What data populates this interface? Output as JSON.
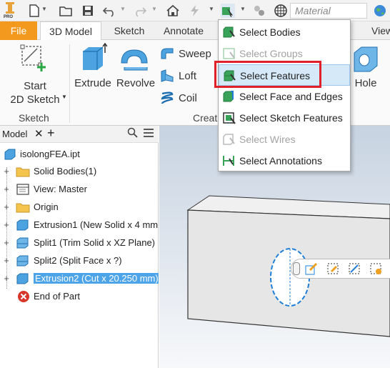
{
  "toolbar": {
    "material_placeholder": "Material",
    "icons": [
      "app-logo-icon",
      "new-file-icon",
      "open-icon",
      "save-icon",
      "undo-icon",
      "redo-icon",
      "home-icon",
      "update-icon",
      "select-filter-icon",
      "appearance-icon",
      "material-ball-icon",
      "globe-icon"
    ],
    "app_logo_text": "PRO"
  },
  "tabs": {
    "file": "File",
    "model": "3D Model",
    "sketch": "Sketch",
    "annotate": "Annotate",
    "view_partial": "View"
  },
  "ribbon": {
    "start_sketch_line1": "Start",
    "start_sketch_line2": "2D Sketch",
    "extrude": "Extrude",
    "revolve": "Revolve",
    "sweep": "Sweep",
    "loft": "Loft",
    "coil": "Coil",
    "hole": "Hole",
    "group_sketch": "Sketch",
    "group_create_partial": "Creat"
  },
  "browser": {
    "tab_label": "Model",
    "root": "isolongFEA.ipt",
    "items": [
      {
        "label": "Solid Bodies(1)",
        "icon": "folder-icon"
      },
      {
        "label": "View: Master",
        "icon": "view-icon"
      },
      {
        "label": "Origin",
        "icon": "folder-icon"
      },
      {
        "label": "Extrusion1 (New Solid x 4 mm",
        "icon": "extrusion-icon"
      },
      {
        "label": "Split1 (Trim Solid x XZ Plane)",
        "icon": "split-icon"
      },
      {
        "label": "Split2 (Split Face x ?)",
        "icon": "split-icon"
      },
      {
        "label": "Extrusion2 (Cut x 20.250 mm)",
        "icon": "extrusion-icon"
      }
    ],
    "end_of_part": "End of Part"
  },
  "menu": {
    "items": [
      {
        "label": "Select Bodies",
        "enabled": true
      },
      {
        "label": "Select Groups",
        "enabled": false
      },
      {
        "label": "Select Features",
        "enabled": true,
        "hovered": true
      },
      {
        "label": "Select Face and Edges",
        "enabled": true
      },
      {
        "label": "Select Sketch Features",
        "enabled": true
      },
      {
        "label": "Select Wires",
        "enabled": false
      },
      {
        "label": "Select Annotations",
        "enabled": true
      }
    ]
  },
  "colors": {
    "file_tab": "#f39a1e",
    "selection": "#4ea4e8",
    "highlight": "#e0212b",
    "menu_hover": "#d6e9f8"
  }
}
